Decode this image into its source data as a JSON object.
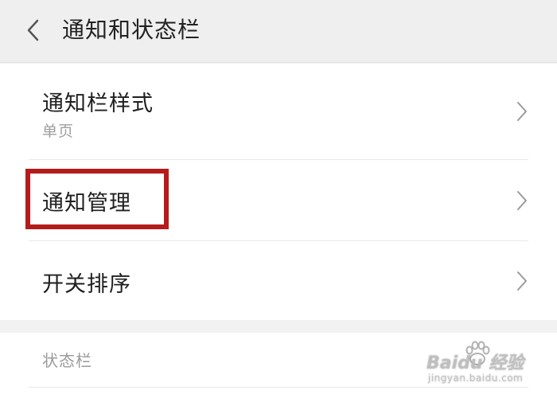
{
  "header": {
    "title": "通知和状态栏",
    "back_icon": "chevron-left-icon"
  },
  "rows": [
    {
      "title": "通知栏样式",
      "subtitle": "单页"
    },
    {
      "title": "通知管理"
    },
    {
      "title": "开关排序"
    }
  ],
  "section": {
    "title": "状态栏"
  },
  "watermark": {
    "brand": "Baidu 经验",
    "sub": "jingyan.baidu.com"
  },
  "colors": {
    "highlight": "#b51b1b",
    "background": "#f2f2f2",
    "card": "#ffffff"
  }
}
